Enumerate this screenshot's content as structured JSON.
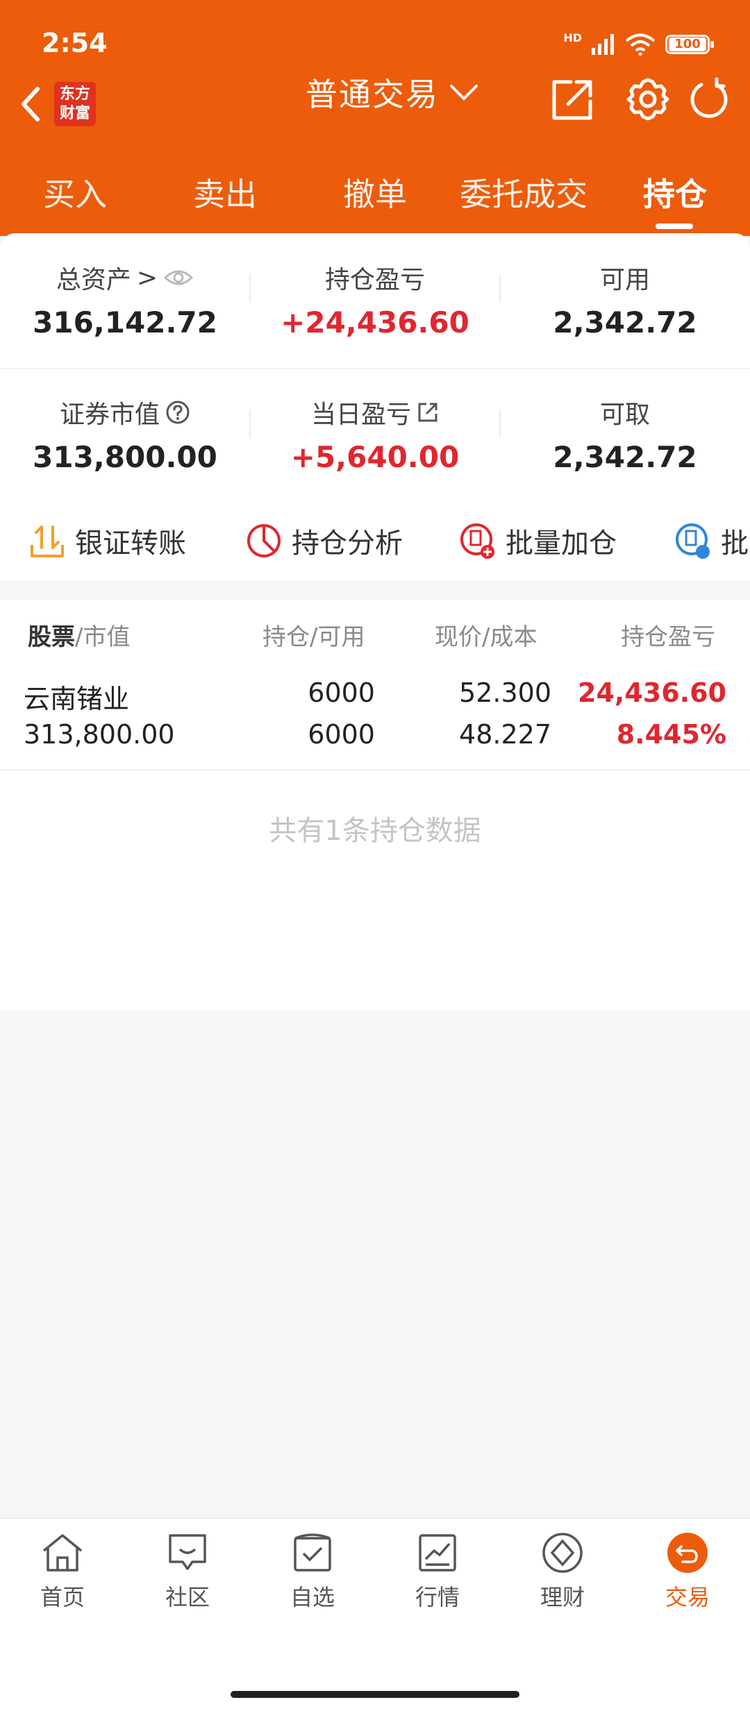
{
  "status_bar": {
    "time": "2:54",
    "network": "HD",
    "battery": "100"
  },
  "header": {
    "logo_text_line1": "东方",
    "logo_text_line2": "财富",
    "title": "普通交易"
  },
  "tabs": [
    {
      "label": "买入"
    },
    {
      "label": "卖出"
    },
    {
      "label": "撤单"
    },
    {
      "label": "委托成交"
    },
    {
      "label": "持仓",
      "active": true
    }
  ],
  "summary": {
    "total_assets_label": "总资产",
    "total_assets_arrow": ">",
    "total_assets_value": "316,142.72",
    "holding_pl_label": "持仓盈亏",
    "holding_pl_value": "+24,436.60",
    "available_label": "可用",
    "available_value": "2,342.72",
    "market_value_label": "证券市值",
    "market_value_value": "313,800.00",
    "daily_pl_label": "当日盈亏",
    "daily_pl_value": "+5,640.00",
    "withdrawable_label": "可取",
    "withdrawable_value": "2,342.72"
  },
  "tools": [
    {
      "label": "银证转账",
      "icon": "transfer-icon"
    },
    {
      "label": "持仓分析",
      "icon": "pie-chart-icon"
    },
    {
      "label": "批量加仓",
      "icon": "batch-add-icon"
    },
    {
      "label": "批量",
      "icon": "batch-icon"
    }
  ],
  "table": {
    "col1_bold": "股票",
    "col1_rest": "/市值",
    "col2": "持仓/可用",
    "col3": "现价/成本",
    "col4": "持仓盈亏",
    "rows": [
      {
        "name": "云南锗业",
        "market_value": "313,800.00",
        "position": "6000",
        "available": "6000",
        "price": "52.300",
        "cost": "48.227",
        "pl": "24,436.60",
        "pl_pct": "8.445%"
      }
    ],
    "footer": "共有1条持仓数据"
  },
  "bottom_nav": [
    {
      "label": "首页",
      "icon": "home-icon"
    },
    {
      "label": "社区",
      "icon": "community-icon"
    },
    {
      "label": "自选",
      "icon": "watchlist-icon"
    },
    {
      "label": "行情",
      "icon": "market-icon"
    },
    {
      "label": "理财",
      "icon": "finance-icon"
    },
    {
      "label": "交易",
      "icon": "trade-icon",
      "active": true
    }
  ],
  "colors": {
    "brand": "#EC5C0B",
    "profit": "#E0262E"
  }
}
